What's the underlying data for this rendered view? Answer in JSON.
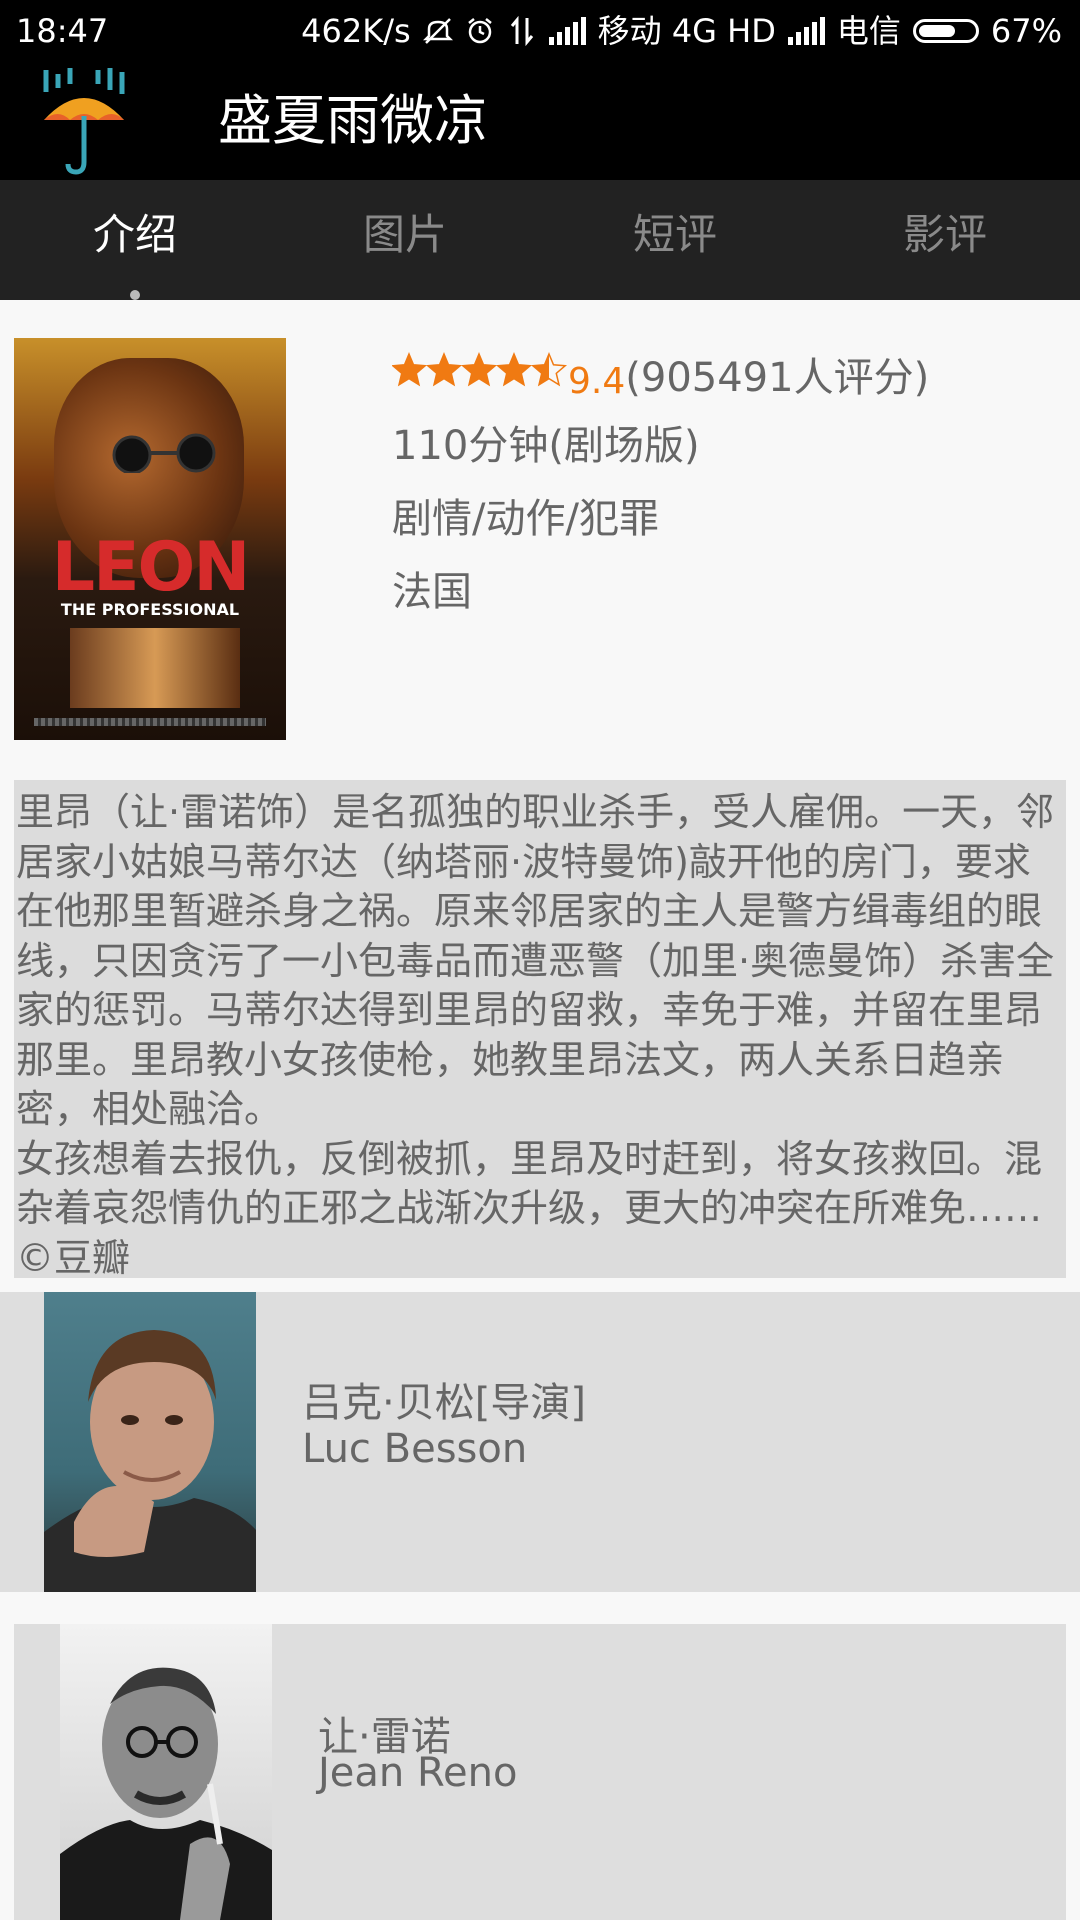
{
  "status_bar": {
    "time": "18:47",
    "speed": "462K/s",
    "carrier1": "移动 4G HD",
    "carrier2": "电信",
    "battery_level": 0.67,
    "battery_text": "67%",
    "icons": [
      "mute-icon",
      "alarm-icon",
      "data-transfer-icon",
      "signal-icon",
      "signal-icon-2",
      "battery-icon"
    ]
  },
  "app": {
    "title": "盛夏雨微凉",
    "logo": "umbrella-rain-icon"
  },
  "tabs": [
    {
      "label": "介绍",
      "active": true
    },
    {
      "label": "图片",
      "active": false
    },
    {
      "label": "短评",
      "active": false
    },
    {
      "label": "影评",
      "active": false
    }
  ],
  "movie": {
    "poster_title": "LEON",
    "poster_subtitle": "THE PROFESSIONAL",
    "stars": 4.5,
    "score": "9.4",
    "votes": "(905491人评分)",
    "duration": "110分钟(剧场版)",
    "genres": "剧情/动作/犯罪",
    "country": "法国",
    "accent_color": "#f07a12"
  },
  "summary": "里昂（让·雷诺饰）是名孤独的职业杀手，受人雇佣。一天，邻居家小姑娘马蒂尔达（纳塔丽·波特曼饰)敲开他的房门，要求在他那里暂避杀身之祸。原来邻居家的主人是警方缉毒组的眼线，只因贪污了一小包毒品而遭恶警（加里·奥德曼饰）杀害全家的惩罚。马蒂尔达得到里昂的留救，幸免于难，并留在里昂那里。里昂教小女孩使枪，她教里昂法文，两人关系日趋亲密，相处融洽。\n女孩想着去报仇，反倒被抓，里昂及时赶到，将女孩救回。混杂着哀怨情仇的正邪之战渐次升级，更大的冲突在所难免……©豆瓣",
  "cast": [
    {
      "name_cn": "吕克·贝松[导演]",
      "name_en": "Luc Besson"
    },
    {
      "name_cn": "让·雷诺",
      "name_en": "Jean Reno"
    }
  ]
}
